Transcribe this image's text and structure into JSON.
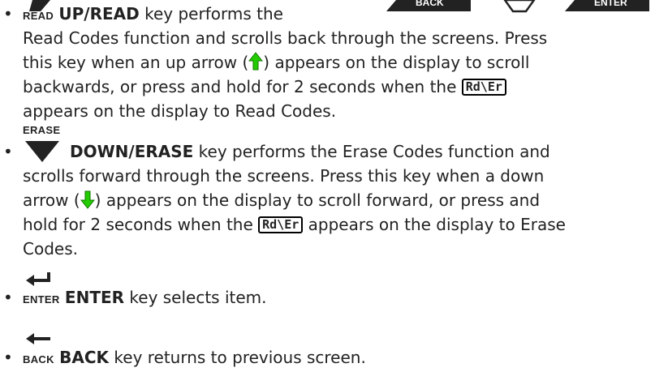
{
  "items": {
    "up": {
      "cap": "READ",
      "title": "UP/READ",
      "l1": " key performs the",
      "l2": "Read Codes function and scrolls back through the screens. Press",
      "l3a": "this key when an up arrow (",
      "l3b": ") appears on the display to scroll",
      "l4a": "backwards, or press and hold for 2 seconds when the ",
      "lcd": "Rd\\Er",
      "l5": "appears on the display to Read Codes."
    },
    "down": {
      "cap": "ERASE",
      "title": "DOWN/ERASE",
      "l1": " key performs the Erase Codes function and",
      "l2": "scrolls forward through the screens. Press this key when a down",
      "l3a": "arrow (",
      "l3b": ") appears on the display to scroll forward, or press and",
      "l4a": "hold for 2 seconds when the ",
      "lcd": "Rd\\Er",
      "l4b": " appears on the display to Erase",
      "l5": "Codes."
    },
    "enter": {
      "cap": "ENTER",
      "title": "ENTER",
      "text": " key selects item."
    },
    "back": {
      "cap": "BACK",
      "title": "BACK",
      "text": " key returns to previous screen."
    }
  },
  "header_keys": {
    "back": "BACK",
    "enter": "ENTER"
  },
  "colors": {
    "arrow_green": "#22cc00",
    "key_dark": "#222222"
  }
}
